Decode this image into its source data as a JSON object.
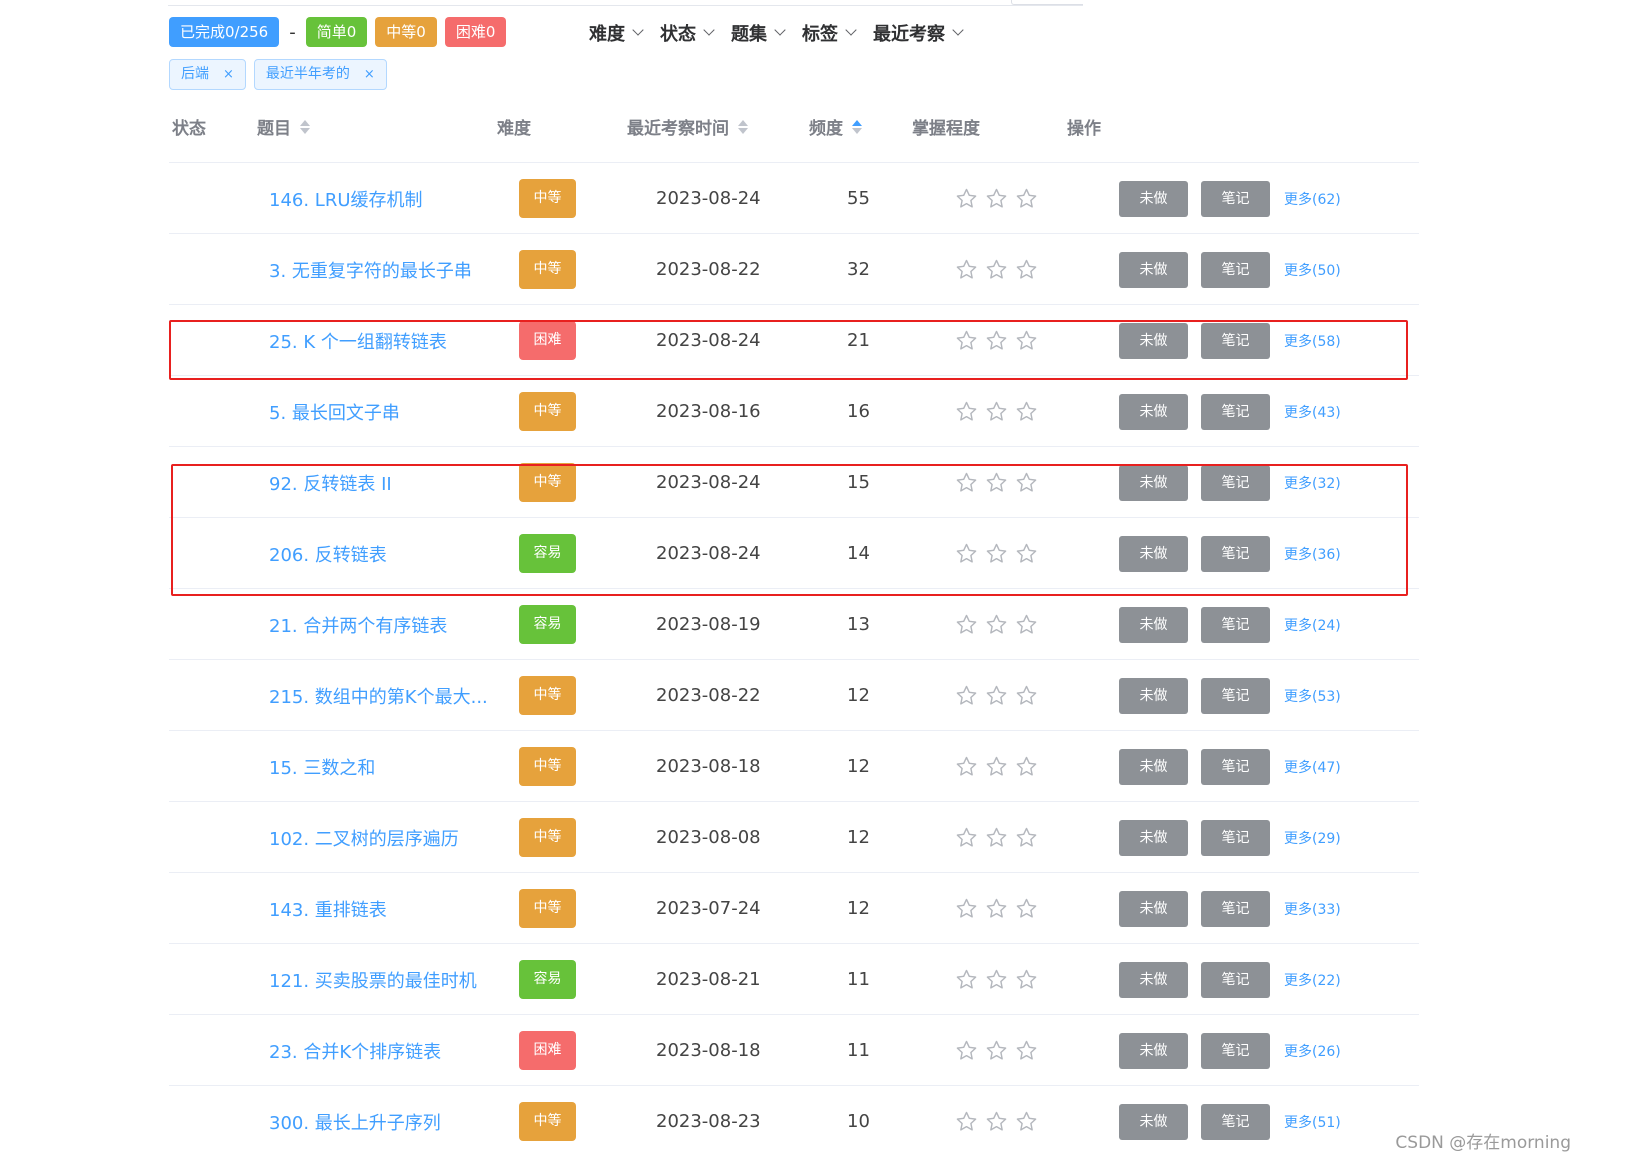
{
  "stats": {
    "done": "已完成0/256",
    "sep": "-",
    "easy": "简单0",
    "medium": "中等0",
    "hard": "困难0"
  },
  "filters": [
    "难度",
    "状态",
    "题集",
    "标签",
    "最近考察"
  ],
  "tags": [
    "后端",
    "最近半年考的"
  ],
  "tag_close": "×",
  "table": {
    "headers": {
      "status": "状态",
      "title": "题目",
      "difficulty": "难度",
      "recent_time": "最近考察时间",
      "frequency": "频度",
      "mastery": "掌握程度",
      "actions": "操作"
    },
    "sorted_column": "频度",
    "rows": [
      {
        "title": "146. LRU缓存机制",
        "difficulty": "中等",
        "level": "m",
        "date": "2023-08-24",
        "freq": "55",
        "more": "更多(62)"
      },
      {
        "title": "3. 无重复字符的最长子串",
        "difficulty": "中等",
        "level": "m",
        "date": "2023-08-22",
        "freq": "32",
        "more": "更多(50)"
      },
      {
        "title": "25. K 个一组翻转链表",
        "difficulty": "困难",
        "level": "h",
        "date": "2023-08-24",
        "freq": "21",
        "more": "更多(58)"
      },
      {
        "title": "5. 最长回文子串",
        "difficulty": "中等",
        "level": "m",
        "date": "2023-08-16",
        "freq": "16",
        "more": "更多(43)"
      },
      {
        "title": "92. 反转链表 II",
        "difficulty": "中等",
        "level": "m",
        "date": "2023-08-24",
        "freq": "15",
        "more": "更多(32)"
      },
      {
        "title": "206. 反转链表",
        "difficulty": "容易",
        "level": "e",
        "date": "2023-08-24",
        "freq": "14",
        "more": "更多(36)"
      },
      {
        "title": "21. 合并两个有序链表",
        "difficulty": "容易",
        "level": "e",
        "date": "2023-08-19",
        "freq": "13",
        "more": "更多(24)"
      },
      {
        "title": "215. 数组中的第K个最大...",
        "difficulty": "中等",
        "level": "m",
        "date": "2023-08-22",
        "freq": "12",
        "more": "更多(53)"
      },
      {
        "title": "15. 三数之和",
        "difficulty": "中等",
        "level": "m",
        "date": "2023-08-18",
        "freq": "12",
        "more": "更多(47)"
      },
      {
        "title": "102. 二叉树的层序遍历",
        "difficulty": "中等",
        "level": "m",
        "date": "2023-08-08",
        "freq": "12",
        "more": "更多(29)"
      },
      {
        "title": "143. 重排链表",
        "difficulty": "中等",
        "level": "m",
        "date": "2023-07-24",
        "freq": "12",
        "more": "更多(33)"
      },
      {
        "title": "121. 买卖股票的最佳时机",
        "difficulty": "容易",
        "level": "e",
        "date": "2023-08-21",
        "freq": "11",
        "more": "更多(22)"
      },
      {
        "title": "23. 合并K个排序链表",
        "difficulty": "困难",
        "level": "h",
        "date": "2023-08-18",
        "freq": "11",
        "more": "更多(26)"
      },
      {
        "title": "300. 最长上升子序列",
        "difficulty": "中等",
        "level": "m",
        "date": "2023-08-23",
        "freq": "10",
        "more": "更多(51)"
      }
    ],
    "mastery_stars": 3,
    "btn_not_done": "未做",
    "btn_note": "笔记"
  },
  "highlights": [
    [
      "25. K 个一组翻转链表"
    ],
    [
      "92. 反转链表 II",
      "206. 反转链表"
    ]
  ],
  "colors": {
    "primary": "#409eff",
    "easy": "#67c23a",
    "medium": "#e6a23c",
    "hard": "#f56c6c",
    "action_button": "#8d9196",
    "highlight": "#e8201f"
  },
  "watermark": "CSDN @存在morning"
}
